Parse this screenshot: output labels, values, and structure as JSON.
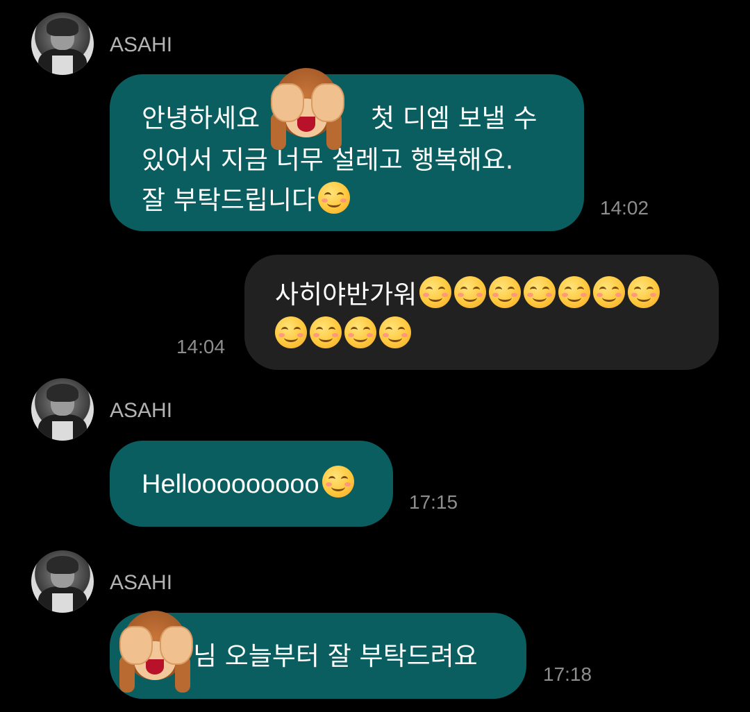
{
  "chat": {
    "messages": [
      {
        "sender": "ASAHI",
        "lines": [
          "안녕하세요",
          "첫 디엠 보낼 수",
          "있어서 지금 너무 설레고 행복해요.",
          "잘 부탁드립니다"
        ],
        "time": "14:02"
      },
      {
        "sender": "me",
        "lines": [
          "사히야반가워"
        ],
        "time": "14:04"
      },
      {
        "sender": "ASAHI",
        "lines": [
          "Hellooooooooo"
        ],
        "time": "17:15"
      },
      {
        "sender": "ASAHI",
        "lines": [
          "님 오늘부터 잘 부탁드려요"
        ],
        "time": "17:18"
      }
    ]
  },
  "icons": {
    "smile": "smiling-face-emoji",
    "monkey": "see-no-evil-monkey-emoji",
    "avatar": "profile-photo"
  },
  "colors": {
    "background": "#000000",
    "incoming_bubble": "#0b5e60",
    "outgoing_bubble": "#212121",
    "sender_name": "#b3b3b3",
    "timestamp": "#8e8e8e"
  }
}
